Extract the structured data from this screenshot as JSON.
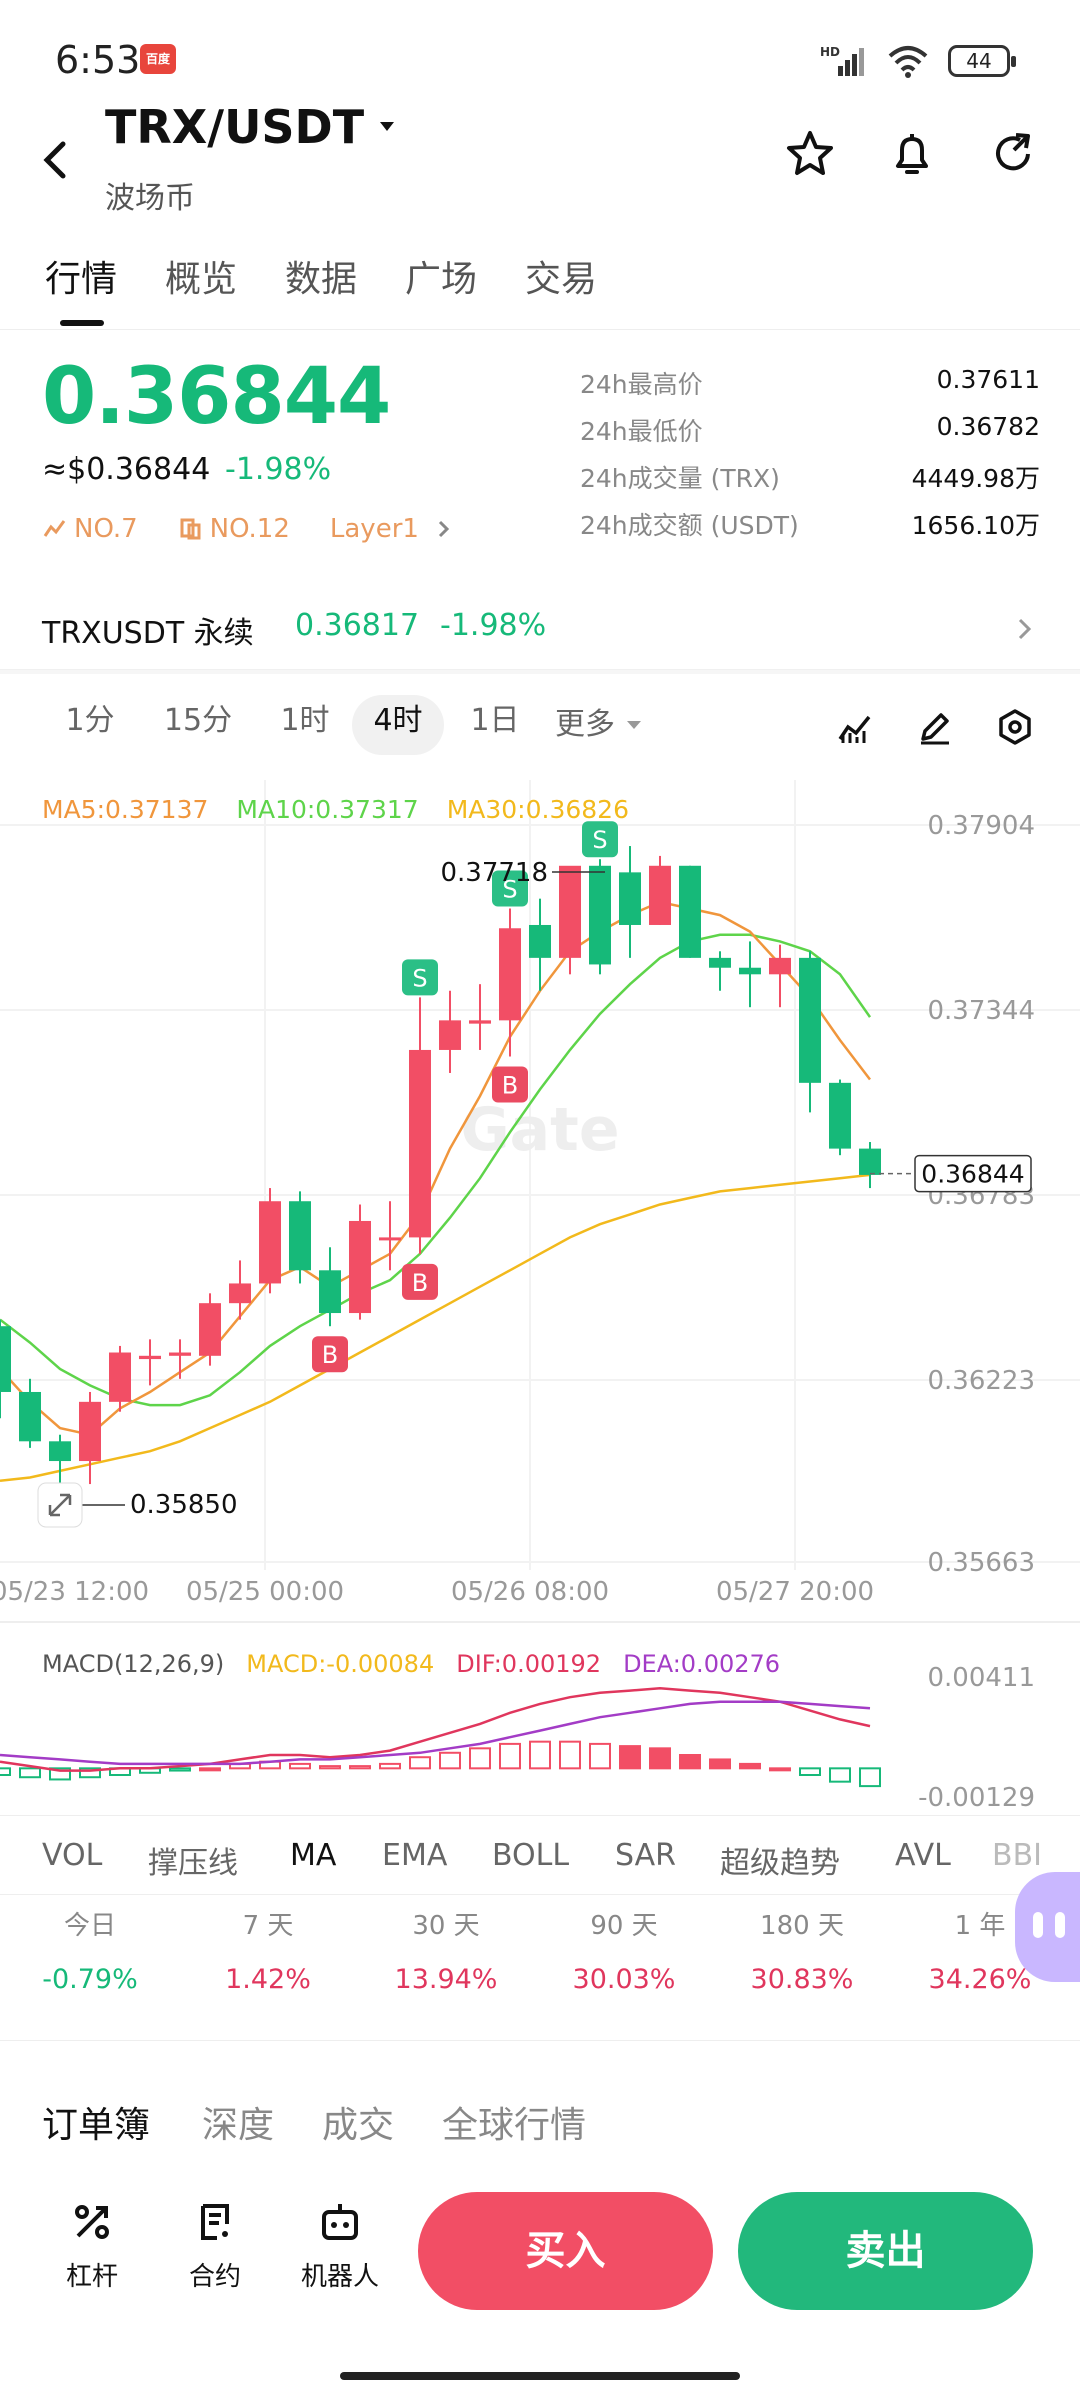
{
  "status": {
    "time": "6:53",
    "app_badge": "百度",
    "battery": "44",
    "network": "HD"
  },
  "header": {
    "pair": "TRX/USDT",
    "name": "波场币"
  },
  "tabs": [
    {
      "label": "行情"
    },
    {
      "label": "概览"
    },
    {
      "label": "数据"
    },
    {
      "label": "广场"
    },
    {
      "label": "交易"
    }
  ],
  "ticker": {
    "price": "0.36844",
    "usd": "≈$0.36844",
    "change": "-1.98%",
    "tags": [
      "NO.7",
      "NO.12",
      "Layer1"
    ],
    "stats": [
      {
        "label": "24h最高价",
        "value": "0.37611"
      },
      {
        "label": "24h最低价",
        "value": "0.36782"
      },
      {
        "label": "24h成交量 (TRX)",
        "value": "4449.98万"
      },
      {
        "label": "24h成交额 (USDT)",
        "value": "1656.10万"
      }
    ]
  },
  "perp": {
    "name": "TRXUSDT 永续",
    "price": "0.36817",
    "change": "-1.98%"
  },
  "intervals": [
    {
      "label": "1分"
    },
    {
      "label": "15分"
    },
    {
      "label": "1时"
    },
    {
      "label": "4时"
    },
    {
      "label": "1日"
    },
    {
      "label": "更多"
    }
  ],
  "ma_legend": {
    "ma5": "MA5:0.37137",
    "ma10": "MA10:0.37317",
    "ma30": "MA30:0.36826"
  },
  "macd_legend": {
    "title": "MACD(12,26,9)",
    "macd": "MACD:-0.00084",
    "dif": "DIF:0.00192",
    "dea": "DEA:0.00276"
  },
  "chart_data": {
    "type": "candlestick",
    "y_ticks": [
      "0.37904",
      "0.37344",
      "0.36783",
      "0.36223",
      "0.35663"
    ],
    "x_ticks": [
      "05/23 12:00",
      "05/25 00:00",
      "05/26 08:00",
      "05/27 20:00"
    ],
    "high_label": "0.37718",
    "low_label": "0.35850",
    "last_price": "0.36844",
    "macd_ticks": [
      "0.00411",
      "-0.00129"
    ],
    "markers": [
      {
        "type": "S",
        "candle": 14
      },
      {
        "type": "S",
        "candle": 17
      },
      {
        "type": "S",
        "candle": 20
      },
      {
        "type": "B",
        "candle": 11
      },
      {
        "type": "B",
        "candle": 14
      },
      {
        "type": "B",
        "candle": 17
      }
    ],
    "candles": [
      {
        "o": 0.3638,
        "h": 0.364,
        "l": 0.361,
        "c": 0.3618
      },
      {
        "o": 0.3618,
        "h": 0.3622,
        "l": 0.3601,
        "c": 0.3603
      },
      {
        "o": 0.3603,
        "h": 0.3605,
        "l": 0.3588,
        "c": 0.3597
      },
      {
        "o": 0.3597,
        "h": 0.3618,
        "l": 0.359,
        "c": 0.3615
      },
      {
        "o": 0.3615,
        "h": 0.3632,
        "l": 0.3612,
        "c": 0.363
      },
      {
        "o": 0.3628,
        "h": 0.3634,
        "l": 0.362,
        "c": 0.3629
      },
      {
        "o": 0.3629,
        "h": 0.3634,
        "l": 0.3622,
        "c": 0.363
      },
      {
        "o": 0.3629,
        "h": 0.3648,
        "l": 0.3626,
        "c": 0.3645
      },
      {
        "o": 0.3645,
        "h": 0.3658,
        "l": 0.364,
        "c": 0.3651
      },
      {
        "o": 0.3651,
        "h": 0.368,
        "l": 0.3648,
        "c": 0.3676
      },
      {
        "o": 0.3676,
        "h": 0.3679,
        "l": 0.3651,
        "c": 0.3655
      },
      {
        "o": 0.3655,
        "h": 0.3662,
        "l": 0.3638,
        "c": 0.3642
      },
      {
        "o": 0.3642,
        "h": 0.3675,
        "l": 0.364,
        "c": 0.367
      },
      {
        "o": 0.3665,
        "h": 0.3676,
        "l": 0.3655,
        "c": 0.3665
      },
      {
        "o": 0.3665,
        "h": 0.3738,
        "l": 0.366,
        "c": 0.3722
      },
      {
        "o": 0.3722,
        "h": 0.374,
        "l": 0.3715,
        "c": 0.3731
      },
      {
        "o": 0.373,
        "h": 0.3742,
        "l": 0.3722,
        "c": 0.3731
      },
      {
        "o": 0.3731,
        "h": 0.3765,
        "l": 0.372,
        "c": 0.3759
      },
      {
        "o": 0.376,
        "h": 0.3768,
        "l": 0.374,
        "c": 0.375
      },
      {
        "o": 0.375,
        "h": 0.3772,
        "l": 0.3745,
        "c": 0.3778
      },
      {
        "o": 0.3778,
        "h": 0.378,
        "l": 0.3745,
        "c": 0.3748
      },
      {
        "o": 0.3776,
        "h": 0.3784,
        "l": 0.375,
        "c": 0.376
      },
      {
        "o": 0.376,
        "h": 0.3781,
        "l": 0.376,
        "c": 0.3778
      },
      {
        "o": 0.3778,
        "h": 0.3778,
        "l": 0.375,
        "c": 0.375
      },
      {
        "o": 0.375,
        "h": 0.3752,
        "l": 0.374,
        "c": 0.3747
      },
      {
        "o": 0.3747,
        "h": 0.3755,
        "l": 0.3735,
        "c": 0.3745
      },
      {
        "o": 0.3745,
        "h": 0.3754,
        "l": 0.3735,
        "c": 0.375
      },
      {
        "o": 0.375,
        "h": 0.3752,
        "l": 0.3703,
        "c": 0.3712
      },
      {
        "o": 0.3712,
        "h": 0.3713,
        "l": 0.369,
        "c": 0.3692
      },
      {
        "o": 0.3692,
        "h": 0.3694,
        "l": 0.368,
        "c": 0.3684
      }
    ],
    "ma5": [
      0.3625,
      0.3615,
      0.3607,
      0.3605,
      0.3613,
      0.3618,
      0.3624,
      0.363,
      0.3641,
      0.3652,
      0.3656,
      0.365,
      0.3655,
      0.366,
      0.3672,
      0.3692,
      0.3708,
      0.3726,
      0.374,
      0.3752,
      0.3758,
      0.3763,
      0.3767,
      0.3765,
      0.3763,
      0.3758,
      0.3748,
      0.3738,
      0.3725,
      0.3713
    ],
    "ma10": [
      0.364,
      0.3633,
      0.3625,
      0.362,
      0.3616,
      0.3614,
      0.3614,
      0.3617,
      0.3624,
      0.3632,
      0.3638,
      0.3643,
      0.3648,
      0.3652,
      0.366,
      0.3671,
      0.3683,
      0.3697,
      0.371,
      0.3722,
      0.3733,
      0.3742,
      0.375,
      0.3755,
      0.3757,
      0.3757,
      0.3755,
      0.3752,
      0.3745,
      0.3732
    ],
    "ma30": [
      0.3591,
      0.3592,
      0.3594,
      0.3596,
      0.3598,
      0.36,
      0.3603,
      0.3607,
      0.3611,
      0.3615,
      0.362,
      0.3625,
      0.363,
      0.3635,
      0.364,
      0.3645,
      0.365,
      0.3655,
      0.366,
      0.3665,
      0.3669,
      0.3672,
      0.3675,
      0.3677,
      0.3679,
      0.368,
      0.3681,
      0.3682,
      0.3683,
      0.3684
    ],
    "dif": [
      0.0003,
      0.0001,
      -0.0001,
      -0.0001,
      0.0,
      0.0,
      0.0001,
      0.0002,
      0.0004,
      0.0006,
      0.0006,
      0.0005,
      0.0006,
      0.0008,
      0.0012,
      0.0016,
      0.002,
      0.0025,
      0.0029,
      0.0032,
      0.0034,
      0.0035,
      0.0036,
      0.0035,
      0.0034,
      0.0032,
      0.003,
      0.0026,
      0.0022,
      0.0019
    ],
    "dea": [
      0.0006,
      0.0005,
      0.0004,
      0.0003,
      0.0002,
      0.0002,
      0.0002,
      0.0002,
      0.0002,
      0.0003,
      0.0004,
      0.0004,
      0.0005,
      0.0006,
      0.0007,
      0.0009,
      0.0011,
      0.0014,
      0.0017,
      0.002,
      0.0023,
      0.0025,
      0.0027,
      0.0029,
      0.003,
      0.003,
      0.003,
      0.0029,
      0.0028,
      0.0027
    ],
    "macd_hist": [
      -0.0003,
      -0.0004,
      -0.0005,
      -0.0004,
      -0.0003,
      -0.0002,
      -0.0001,
      0.0,
      0.0002,
      0.0003,
      0.0002,
      0.0001,
      0.0001,
      0.0002,
      0.0005,
      0.0007,
      0.0009,
      0.0011,
      0.0012,
      0.0012,
      0.0011,
      0.001,
      0.0009,
      0.0006,
      0.0004,
      0.0002,
      0.0,
      -0.0003,
      -0.0006,
      -0.0008
    ]
  },
  "indicators": [
    {
      "label": "VOL"
    },
    {
      "label": "撑压线"
    },
    {
      "label": "MA"
    },
    {
      "label": "EMA"
    },
    {
      "label": "BOLL"
    },
    {
      "label": "SAR"
    },
    {
      "label": "超级趋势"
    },
    {
      "label": "AVL"
    },
    {
      "label": "BBI"
    }
  ],
  "performance": [
    {
      "period": "今日",
      "value": "-0.79%",
      "color": "#16b979"
    },
    {
      "period": "7 天",
      "value": "1.42%",
      "color": "#e0365d"
    },
    {
      "period": "30 天",
      "value": "13.94%",
      "color": "#e0365d"
    },
    {
      "period": "90 天",
      "value": "30.03%",
      "color": "#e0365d"
    },
    {
      "period": "180 天",
      "value": "30.83%",
      "color": "#e0365d"
    },
    {
      "period": "1 年",
      "value": "34.26%",
      "color": "#e0365d"
    }
  ],
  "orderbook_tabs": [
    {
      "label": "订单簿"
    },
    {
      "label": "深度"
    },
    {
      "label": "成交"
    },
    {
      "label": "全球行情"
    }
  ],
  "bottom": {
    "leverage": "杠杆",
    "contract": "合约",
    "robot": "机器人",
    "buy": "买入",
    "sell": "卖出"
  },
  "colors": {
    "up": "#f24e65",
    "down": "#16b979",
    "ma5": "#f0963c",
    "ma10": "#5ed44a",
    "ma30": "#f2b91c",
    "dif": "#e0365d",
    "dea": "#a33cc6"
  }
}
